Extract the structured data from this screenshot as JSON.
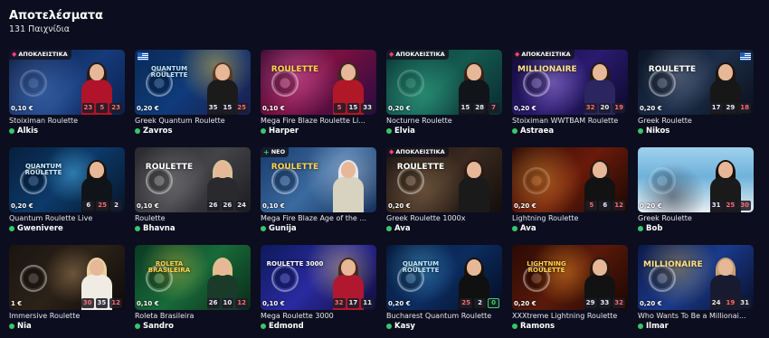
{
  "header": {
    "title": "Αποτελέσματα",
    "count": "131 Παιχνίδια"
  },
  "badges": {
    "exclusive": "ΑΠΟΚΛΕΙΣΤΙΚΑ",
    "new": "ΝΕΟ"
  },
  "colors": {
    "background": "#0c0d1e",
    "online_dot": "#37c76b",
    "exclusive_diamond": "#ff3d7f",
    "red_number": "#ff6b6b",
    "green_number": "#3bd16f"
  },
  "games": [
    {
      "name": "Stoiximan Roulette",
      "dealer": "Alkis",
      "bet": "0,10 €",
      "results": [
        "23",
        "5",
        "23"
      ],
      "result_colors": [
        "red",
        "red",
        "red"
      ],
      "badge": "exclusive",
      "logo": "",
      "theme": "stoiximan"
    },
    {
      "name": "Greek Quantum Roulette",
      "dealer": "Zavros",
      "bet": "0,20 €",
      "results": [
        "35",
        "15",
        "25"
      ],
      "result_colors": [
        "black",
        "black",
        "red"
      ],
      "badge": "",
      "flag": "greece",
      "logo": "QUANTUM ROULETTE",
      "theme": "quantum"
    },
    {
      "name": "Mega Fire Blaze Roulette Live",
      "dealer": "Harper",
      "bet": "0,10 €",
      "results": [
        "5",
        "15",
        "33"
      ],
      "result_colors": [
        "red",
        "black",
        "black"
      ],
      "badge": "",
      "logo": "ROULETTE",
      "theme": "megafire"
    },
    {
      "name": "Nocturne Roulette",
      "dealer": "Elvia",
      "bet": "0,20 €",
      "results": [
        "15",
        "28",
        "7"
      ],
      "result_colors": [
        "black",
        "black",
        "red"
      ],
      "badge": "exclusive",
      "logo": "",
      "theme": "nocturne"
    },
    {
      "name": "Stoiximan WWTBAM Roulette",
      "dealer": "Astraea",
      "bet": "0,20 €",
      "results": [
        "32",
        "20",
        "19"
      ],
      "result_colors": [
        "red",
        "black",
        "red"
      ],
      "badge": "exclusive",
      "logo": "MILLIONAIRE",
      "theme": "wwtbam"
    },
    {
      "name": "Greek Roulette",
      "dealer": "Nikos",
      "bet": "0,20 €",
      "results": [
        "17",
        "29",
        "18"
      ],
      "result_colors": [
        "black",
        "black",
        "red"
      ],
      "badge": "",
      "flag": "greece",
      "logo": "ROULETTE",
      "theme": "greek"
    },
    {
      "name": "Quantum Roulette Live",
      "dealer": "Gwenivere",
      "bet": "0,20 €",
      "results": [
        "6",
        "25",
        "2"
      ],
      "result_colors": [
        "black",
        "red",
        "black"
      ],
      "badge": "",
      "logo": "QUANTUM ROULETTE",
      "theme": "quantumlive"
    },
    {
      "name": "Roulette",
      "dealer": "Bhavna",
      "bet": "0,10 €",
      "results": [
        "26",
        "26",
        "24"
      ],
      "result_colors": [
        "black",
        "black",
        "black"
      ],
      "badge": "",
      "logo": "ROULETTE",
      "theme": "roulette"
    },
    {
      "name": "Mega Fire Blaze Age of the Gods Roulette",
      "dealer": "Gunija",
      "bet": "0,10 €",
      "results": [],
      "result_colors": [],
      "badge": "new",
      "logo": "ROULETTE",
      "theme": "gods"
    },
    {
      "name": "Greek Roulette 1000x",
      "dealer": "Ava",
      "bet": "0,20 €",
      "results": [],
      "result_colors": [],
      "badge": "exclusive",
      "logo": "ROULETTE",
      "theme": "greek1000"
    },
    {
      "name": "Lightning Roulette",
      "dealer": "Ava",
      "bet": "0,20 €",
      "results": [
        "5",
        "6",
        "12"
      ],
      "result_colors": [
        "red",
        "black",
        "red"
      ],
      "badge": "",
      "logo": "",
      "theme": "lightning"
    },
    {
      "name": "Greek Roulette",
      "dealer": "Bob",
      "bet": "0,20 €",
      "results": [
        "31",
        "25",
        "30"
      ],
      "result_colors": [
        "black",
        "red",
        "red"
      ],
      "badge": "",
      "logo": "",
      "theme": "greekbeach"
    },
    {
      "name": "Immersive Roulette",
      "dealer": "Nia",
      "bet": "1 €",
      "results": [
        "30",
        "35",
        "12"
      ],
      "result_colors": [
        "red",
        "black",
        "red"
      ],
      "badge": "",
      "logo": "",
      "theme": "immersive"
    },
    {
      "name": "Roleta Brasileira",
      "dealer": "Sandro",
      "bet": "0,10 €",
      "results": [
        "26",
        "10",
        "12"
      ],
      "result_colors": [
        "black",
        "black",
        "red"
      ],
      "badge": "",
      "logo": "ROLETA BRASILEIRA",
      "theme": "brasileira"
    },
    {
      "name": "Mega Roulette 3000",
      "dealer": "Edmond",
      "bet": "0,10 €",
      "results": [
        "32",
        "17",
        "11"
      ],
      "result_colors": [
        "red",
        "black",
        "black"
      ],
      "badge": "",
      "logo": "ROULETTE 3000",
      "theme": "mega3000"
    },
    {
      "name": "Bucharest Quantum Roulette",
      "dealer": "Kasy",
      "bet": "0,20 €",
      "results": [
        "25",
        "2",
        "0"
      ],
      "result_colors": [
        "red",
        "black",
        "green"
      ],
      "badge": "",
      "logo": "QUANTUM ROULETTE",
      "theme": "bucharest"
    },
    {
      "name": "XXXtreme Lightning Roulette",
      "dealer": "Ramons",
      "bet": "0,20 €",
      "results": [
        "29",
        "33",
        "32"
      ],
      "result_colors": [
        "black",
        "black",
        "red"
      ],
      "badge": "",
      "logo": "LIGHTNING ROULETTE",
      "theme": "xxxtreme"
    },
    {
      "name": "Who Wants To Be a Millionaire? Roulette",
      "dealer": "Ilmar",
      "bet": "0,20 €",
      "results": [
        "24",
        "19",
        "31"
      ],
      "result_colors": [
        "black",
        "red",
        "black"
      ],
      "badge": "",
      "logo": "MILLIONAIRE",
      "theme": "millionaire"
    }
  ]
}
